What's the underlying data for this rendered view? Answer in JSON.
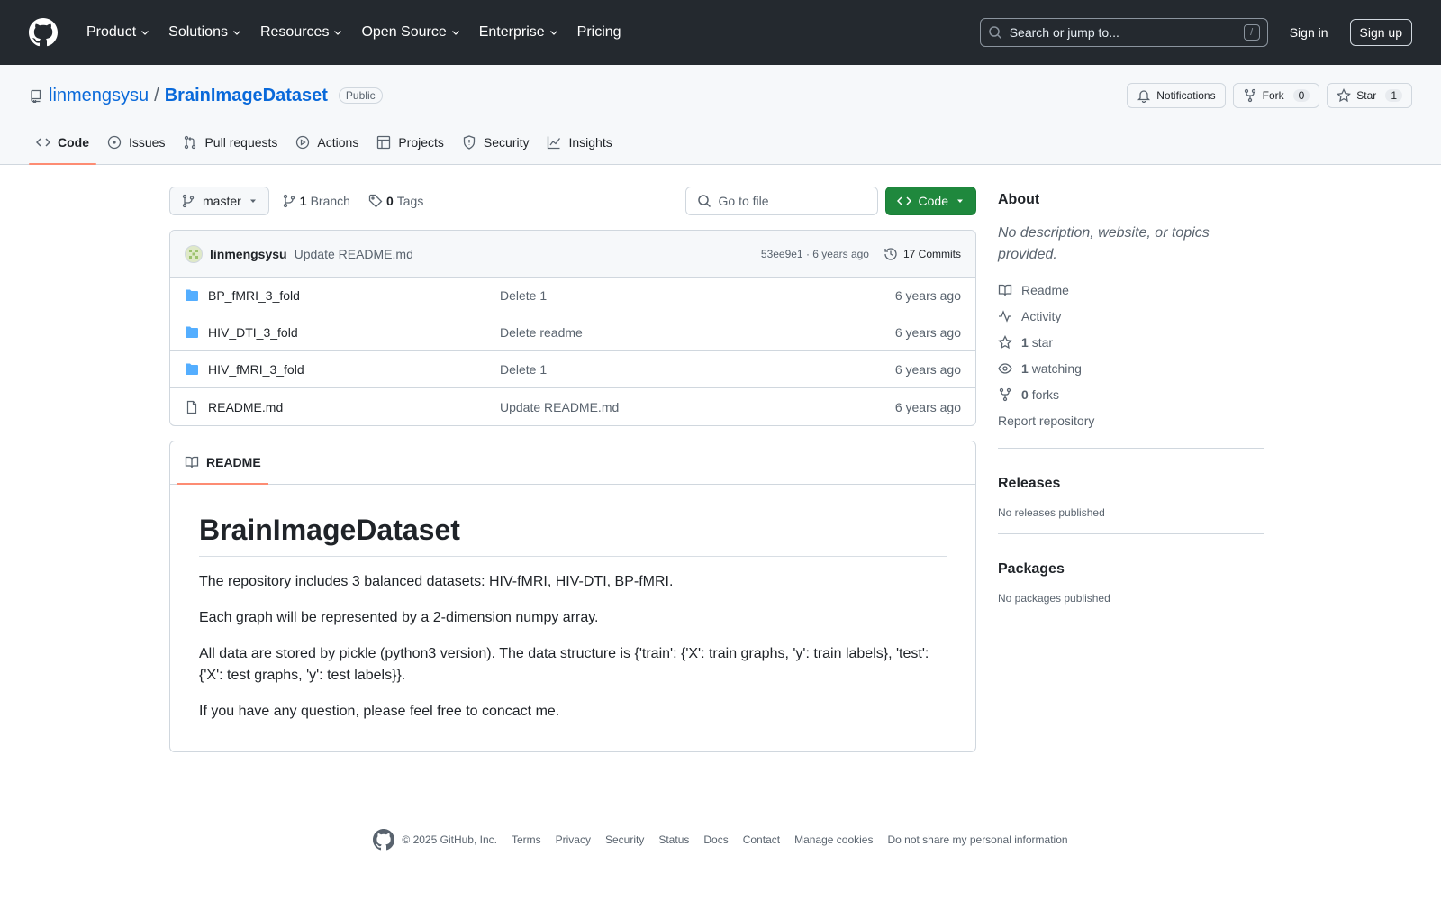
{
  "header": {
    "nav": [
      "Product",
      "Solutions",
      "Resources",
      "Open Source",
      "Enterprise",
      "Pricing"
    ],
    "search_placeholder": "Search or jump to...",
    "search_key": "/",
    "sign_in": "Sign in",
    "sign_up": "Sign up"
  },
  "repo": {
    "owner": "linmengsysu",
    "separator": "/",
    "name": "BrainImageDataset",
    "visibility": "Public",
    "notifications_label": "Notifications",
    "fork_label": "Fork",
    "fork_count": "0",
    "star_label": "Star",
    "star_count": "1",
    "tabs": [
      "Code",
      "Issues",
      "Pull requests",
      "Actions",
      "Projects",
      "Security",
      "Insights"
    ]
  },
  "toolbar": {
    "branch": "master",
    "branch_count": "1",
    "branch_label": "Branch",
    "tag_count": "0",
    "tag_label": "Tags",
    "goto_placeholder": "Go to file",
    "code_label": "Code"
  },
  "commit": {
    "author": "linmengsysu",
    "message": "Update README.md",
    "hash_age": "53ee9e1 · 6 years ago",
    "commits_label": "17 Commits"
  },
  "files": [
    {
      "name": "BP_fMRI_3_fold",
      "type": "dir",
      "commit": "Delete 1",
      "age": "6 years ago"
    },
    {
      "name": "HIV_DTI_3_fold",
      "type": "dir",
      "commit": "Delete readme",
      "age": "6 years ago"
    },
    {
      "name": "HIV_fMRI_3_fold",
      "type": "dir",
      "commit": "Delete 1",
      "age": "6 years ago"
    },
    {
      "name": "README.md",
      "type": "file",
      "commit": "Update README.md",
      "age": "6 years ago"
    }
  ],
  "readme": {
    "tab_label": "README",
    "title": "BrainImageDataset",
    "paragraphs": [
      "The repository includes 3 balanced datasets: HIV-fMRI, HIV-DTI, BP-fMRI.",
      "Each graph will be represented by a 2-dimension numpy array.",
      "All data are stored by pickle (python3 version). The data structure is {'train': {'X': train graphs, 'y': train labels}, 'test': {'X': test graphs, 'y': test labels}}.",
      "If you have any question, please feel free to concact me."
    ]
  },
  "sidebar": {
    "about_title": "About",
    "about_desc": "No description, website, or topics provided.",
    "readme_link": "Readme",
    "activity_link": "Activity",
    "stars_count": "1",
    "stars_label": "star",
    "watching_count": "1",
    "watching_label": "watching",
    "forks_count": "0",
    "forks_label": "forks",
    "report_link": "Report repository",
    "releases_title": "Releases",
    "releases_empty": "No releases published",
    "packages_title": "Packages",
    "packages_empty": "No packages published"
  },
  "footer": {
    "copyright": "© 2025 GitHub, Inc.",
    "links": [
      "Terms",
      "Privacy",
      "Security",
      "Status",
      "Docs",
      "Contact",
      "Manage cookies",
      "Do not share my personal information"
    ]
  },
  "colors": {
    "header_bg": "#24292f",
    "link": "#0969da",
    "code_button": "#1f883d",
    "active_tab": "#fd8c73",
    "folder": "#54aeff"
  }
}
